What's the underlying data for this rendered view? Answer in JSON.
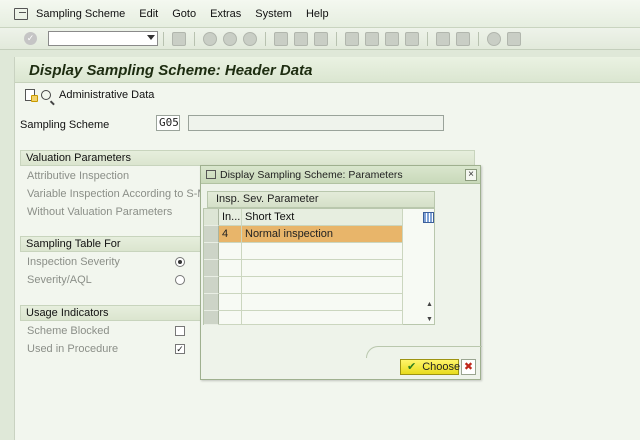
{
  "menu": [
    {
      "label": "Sampling Scheme"
    },
    {
      "label": "Edit"
    },
    {
      "label": "Goto"
    },
    {
      "label": "Extras"
    },
    {
      "label": "System"
    },
    {
      "label": "Help"
    }
  ],
  "toolbar": {
    "command_field_value": ""
  },
  "page": {
    "title": "Display Sampling Scheme: Header Data",
    "admin_button_label": "Administrative Data"
  },
  "scheme": {
    "label": "Sampling Scheme",
    "value": "G05",
    "description": ""
  },
  "valuation": {
    "header": "Valuation Parameters",
    "rows": [
      "Attributive Inspection",
      "Variable Inspection According to S-Metho",
      "Without Valuation Parameters"
    ]
  },
  "sampling_table": {
    "header": "Sampling Table For",
    "rows": [
      {
        "label": "Inspection Severity",
        "selected": true
      },
      {
        "label": "Severity/AQL",
        "selected": false
      }
    ]
  },
  "usage": {
    "header": "Usage Indicators",
    "rows": [
      {
        "label": "Scheme Blocked",
        "checked": false
      },
      {
        "label": "Used in Procedure",
        "checked": true
      }
    ]
  },
  "dialog": {
    "title": "Display Sampling Scheme: Parameters",
    "close_glyph": "×",
    "table_title": "Insp. Sev. Parameter",
    "columns": [
      "In...",
      "Short Text"
    ],
    "rows": [
      {
        "col1": "4",
        "col2": "Normal inspection"
      }
    ],
    "choose_label": "Choose",
    "choose_glyph": "✔",
    "cancel_glyph": "✖",
    "scroll_up_glyph": "▲",
    "scroll_down_glyph": "▼"
  },
  "colors": {
    "highlight_row": "#e8b56a",
    "choose_button": "#f2e62f",
    "cancel_icon": "#c0281c"
  }
}
